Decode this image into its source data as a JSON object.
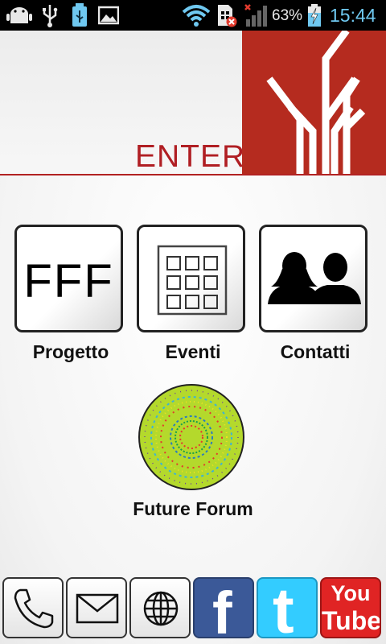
{
  "status_bar": {
    "battery_percent": "63%",
    "time": "15:44",
    "icons": [
      "android-debug-icon",
      "usb-icon",
      "usb-storage-icon",
      "image-icon",
      "wifi-icon",
      "sim-error-icon",
      "signal-icon",
      "battery-charging-icon"
    ]
  },
  "header": {
    "title": "ENTER",
    "logo_icon": "tree-logo-icon",
    "accent_color": "#b52b1f"
  },
  "tiles": [
    {
      "label": "Progetto",
      "icon_text": "FFF"
    },
    {
      "label": "Eventi",
      "icon": "calendar-grid-icon"
    },
    {
      "label": "Contatti",
      "icon": "people-icon"
    }
  ],
  "forum": {
    "label": "Future Forum",
    "icon": "mandala-logo-icon"
  },
  "bottom_bar": {
    "buttons": [
      {
        "name": "phone",
        "icon": "phone-icon"
      },
      {
        "name": "email",
        "icon": "mail-icon"
      },
      {
        "name": "web",
        "icon": "globe-icon"
      },
      {
        "name": "facebook",
        "icon": "facebook-icon",
        "glyph": "f",
        "color": "#3b5998"
      },
      {
        "name": "twitter",
        "icon": "twitter-icon",
        "glyph": "t",
        "color": "#33ccff"
      },
      {
        "name": "youtube",
        "icon": "youtube-icon",
        "glyph_top": "You",
        "glyph_bottom": "Tube",
        "color": "#e02424"
      }
    ]
  }
}
